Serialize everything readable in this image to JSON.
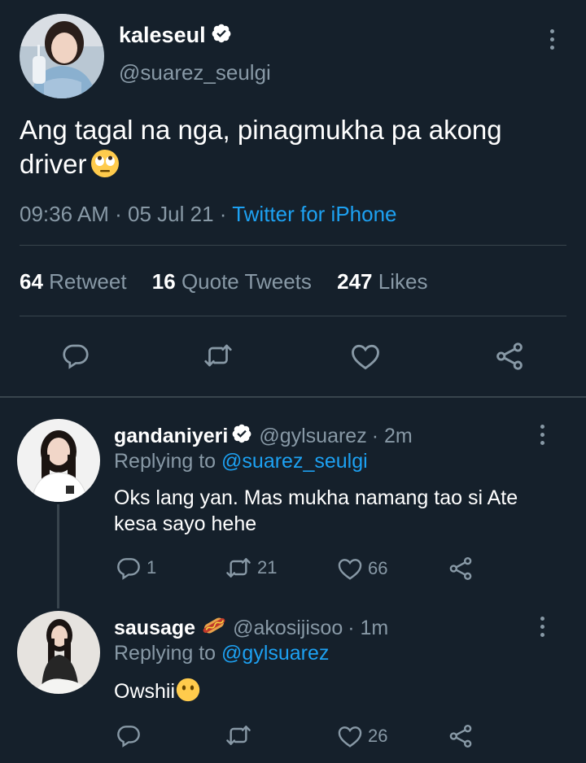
{
  "main_tweet": {
    "display_name": "kaleseul",
    "handle": "@suarez_seulgi",
    "text": "Ang tagal na nga, pinagmukha pa akong driver",
    "emoji": "face-with-rolling-eyes",
    "time": "09:36 AM",
    "date": "05 Jul 21",
    "separator": "·",
    "source": "Twitter for iPhone",
    "stats": {
      "retweets_count": "64",
      "retweets_label": "Retweet",
      "quotes_count": "16",
      "quotes_label": "Quote Tweets",
      "likes_count": "247",
      "likes_label": "Likes"
    }
  },
  "replies": [
    {
      "display_name": "gandaniyeri",
      "handle": "@gylsuarez",
      "time": "· 2m",
      "replying_prefix": "Replying to",
      "replying_to": "@suarez_seulgi",
      "text": "Oks lang yan. Mas mukha namang tao si Ate kesa sayo hehe",
      "reply_count": "1",
      "retweet_count": "21",
      "like_count": "66"
    },
    {
      "display_name": "sausage",
      "name_emoji": "hot-dog",
      "handle": "@akosijisoo",
      "time": "· 1m",
      "replying_prefix": "Replying to",
      "replying_to": "@gylsuarez",
      "text": "Owshii",
      "text_emoji": "face-without-mouth",
      "reply_count": "",
      "retweet_count": "",
      "like_count": "26"
    }
  ],
  "colors": {
    "background": "#15202b",
    "text": "#ffffff",
    "muted": "#8899a6",
    "accent": "#1da1f2",
    "divider": "#38444d"
  },
  "icons": [
    "verified-icon",
    "more-icon",
    "reply-icon",
    "retweet-icon",
    "like-icon",
    "share-icon"
  ]
}
